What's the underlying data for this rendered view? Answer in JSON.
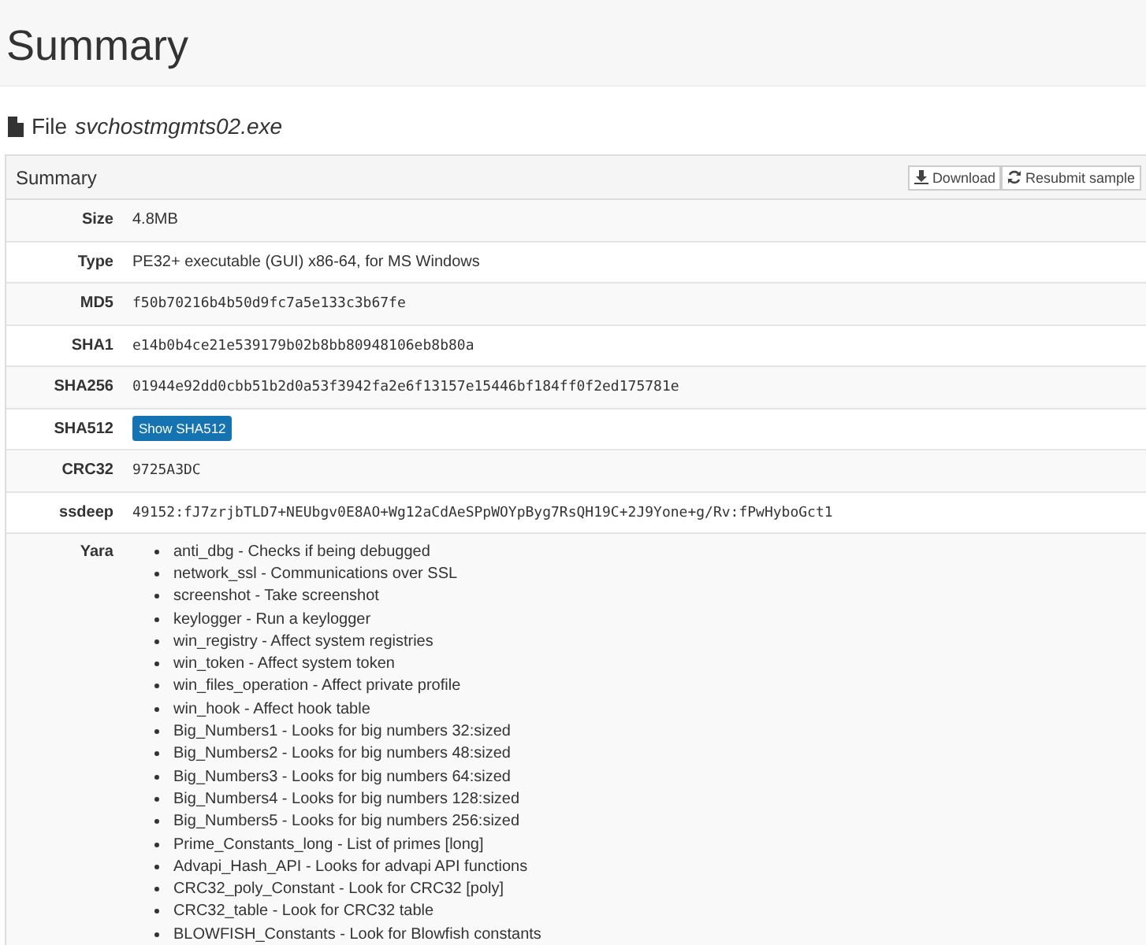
{
  "page_title": "Summary",
  "file": {
    "label": "File",
    "name": "svchostmgmts02.exe"
  },
  "panel": {
    "title": "Summary",
    "buttons": [
      {
        "label": "Download",
        "kind": "download"
      },
      {
        "label": "Resubmit sample",
        "kind": "resubmit"
      }
    ]
  },
  "rows": [
    {
      "label": "Size",
      "kind": "text",
      "value": "4.8MB"
    },
    {
      "label": "Type",
      "kind": "text",
      "value": "PE32+ executable (GUI) x86-64, for MS Windows"
    },
    {
      "label": "MD5",
      "kind": "mono",
      "value": "f50b70216b4b50d9fc7a5e133c3b67fe"
    },
    {
      "label": "SHA1",
      "kind": "mono",
      "value": "e14b0b4ce21e539179b02b8bb80948106eb8b80a"
    },
    {
      "label": "SHA256",
      "kind": "mono",
      "value": "01944e92dd0cbb51b2d0a53f3942fa2e6f13157e15446bf184ff0f2ed175781e"
    },
    {
      "label": "SHA512",
      "kind": "button",
      "value": "Show SHA512"
    },
    {
      "label": "CRC32",
      "kind": "mono",
      "value": "9725A3DC"
    },
    {
      "label": "ssdeep",
      "kind": "mono",
      "value": "49152:fJ7zrjbTLD7+NEUbgv0E8AO+Wg12aCdAeSPpWOYpByg7RsQH19C+2J9Yone+g/Rv:fPwHyboGct1"
    },
    {
      "label": "Yara",
      "kind": "list",
      "items": [
        "anti_dbg - Checks if being debugged",
        "network_ssl - Communications over SSL",
        "screenshot - Take screenshot",
        "keylogger - Run a keylogger",
        "win_registry - Affect system registries",
        "win_token - Affect system token",
        "win_files_operation - Affect private profile",
        "win_hook - Affect hook table",
        "Big_Numbers1 - Looks for big numbers 32:sized",
        "Big_Numbers2 - Looks for big numbers 48:sized",
        "Big_Numbers3 - Looks for big numbers 64:sized",
        "Big_Numbers4 - Looks for big numbers 128:sized",
        "Big_Numbers5 - Looks for big numbers 256:sized",
        "Prime_Constants_long - List of primes [long]",
        "Advapi_Hash_API - Looks for advapi API functions",
        "CRC32_poly_Constant - Look for CRC32 [poly]",
        "CRC32_table - Look for CRC32 table",
        "BLOWFISH_Constants - Look for Blowfish constants"
      ]
    }
  ]
}
